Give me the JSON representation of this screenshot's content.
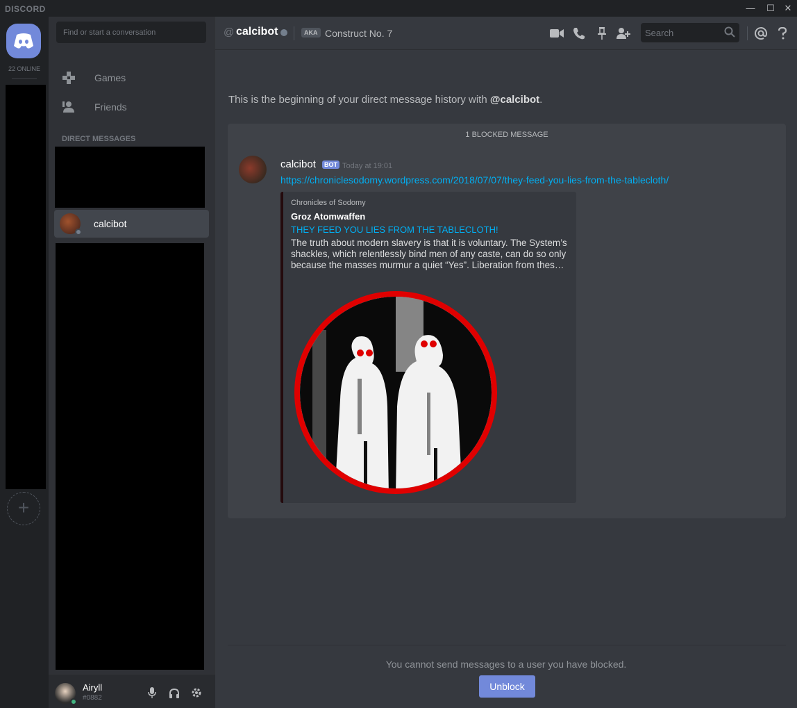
{
  "titlebar": {
    "brand": "DISCORD",
    "minimize": "—",
    "maximize": "☐",
    "close": "✕"
  },
  "guilds": {
    "online_count": "22 ONLINE",
    "add_label": "+"
  },
  "sidebar": {
    "search_placeholder": "Find or start a conversation",
    "nav": [
      {
        "label": "Games",
        "icon": "gamepad-icon"
      },
      {
        "label": "Friends",
        "icon": "friends-icon"
      }
    ],
    "dm_header": "DIRECT MESSAGES",
    "selected_dm": {
      "name": "calcibot",
      "status": "offline"
    }
  },
  "user_panel": {
    "username": "Airyll",
    "tag": "#0882",
    "status": "online"
  },
  "header": {
    "at_symbol": "@",
    "name": "calcibot",
    "aka_label": "AKA",
    "nickname": "Construct No. 7",
    "search_placeholder": "Search"
  },
  "messages": {
    "intro_prefix": "This is the beginning of your direct message history with ",
    "intro_user": "@calcibot",
    "intro_suffix": ".",
    "blocked_label": "1 BLOCKED MESSAGE",
    "author": "calcibot",
    "bot_tag": "BOT",
    "time": "Today at 19:01",
    "link": "https://chroniclesodomy.wordpress.com/2018/07/07/they-feed-you-lies-from-the-tablecloth/",
    "embed": {
      "provider": "Chronicles of Sodomy",
      "author": "Groz Atomwaffen",
      "title": "THEY FEED YOU LIES FROM THE TABLECLOTH!",
      "description": "The truth about modern slavery is that it is voluntary. The System’s shackles, which relentlessly bind men of any caste, can do so only because the masses murmur a quiet “Yes”. Liberation from thes…"
    }
  },
  "composer": {
    "blocked_note": "You cannot send messages to a user you have blocked.",
    "unblock_label": "Unblock"
  },
  "colors": {
    "accent": "#7289da",
    "link": "#00b0f4",
    "online": "#43b581",
    "offline": "#747f8d",
    "embed_bar": "#240a0d"
  }
}
